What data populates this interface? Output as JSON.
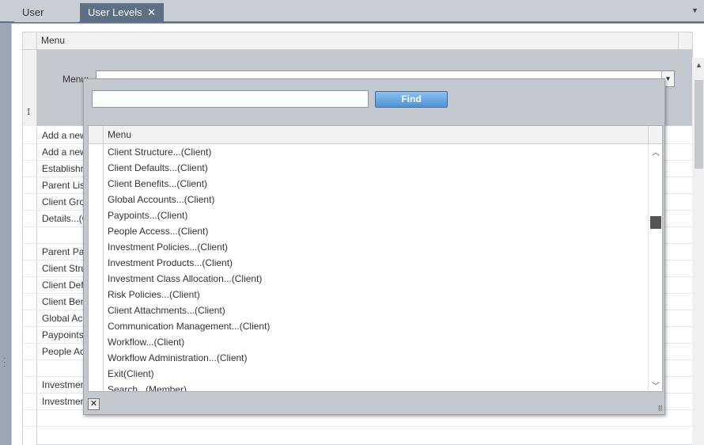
{
  "tabs": [
    {
      "label": "User Levels"
    },
    {
      "label": "User Levels",
      "close": "✕"
    }
  ],
  "panel": {
    "header_label": "Menu",
    "filter_label": "Menu:",
    "combo_value": "",
    "cursor_glyph": "I"
  },
  "background_rows": [
    "Add a new",
    "Add a new",
    "Establishm",
    "Parent List",
    "Client Grou",
    "Details...(C",
    "",
    "Parent Pay",
    "Client Stru",
    "Client Defa",
    "Client Ben",
    "Global Acc",
    "Paypoints.",
    "People Acc",
    "",
    "Investmen",
    "Investment Products...(Client)",
    ""
  ],
  "popup": {
    "search_value": "",
    "find_label": "Find",
    "list_header": "Menu",
    "items": [
      "Client Structure...(Client)",
      "Client Defaults...(Client)",
      "Client Benefits...(Client)",
      "Global Accounts...(Client)",
      "Paypoints...(Client)",
      "People Access...(Client)",
      "Investment Policies...(Client)",
      "Investment Products...(Client)",
      "Investment Class Allocation...(Client)",
      "Risk Policies...(Client)",
      "Client Attachments...(Client)",
      "Communication Management...(Client)",
      "Workflow...(Client)",
      "Workflow Administration...(Client)",
      "Exit(Client)",
      "Search...(Member)"
    ],
    "close_glyph": "✕"
  },
  "icons": {
    "tab_menu": "chevron-down-icon",
    "combo_dropdown": "chevron-down-icon",
    "scroll_up": "chevron-up-icon",
    "scroll_down": "chevron-down-icon",
    "popup_close": "close-icon",
    "resize_grip": "resize-grip-icon"
  },
  "colors": {
    "active_tab": "#5f6f86",
    "find_button": "#4f93d6",
    "panel_gray": "#c3c7ce"
  }
}
